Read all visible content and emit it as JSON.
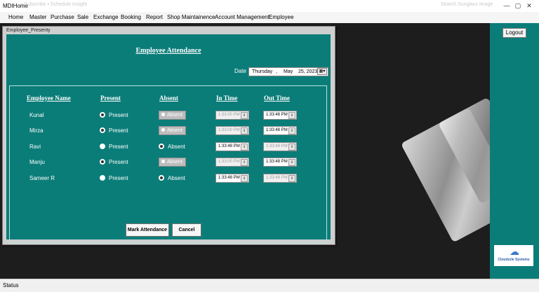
{
  "window": {
    "title": "MDIHome",
    "ghost_text": "▪  Subscribe  ▪  Schedule  Insight",
    "ghost_search": "Search Sunglass Image",
    "controls": [
      "—",
      "▢",
      "✕"
    ]
  },
  "menu": [
    "Home",
    "Master",
    "Purchase",
    "Sale",
    "Exchange",
    "Booking",
    "Report",
    "Shop Maintainence",
    "Account Management",
    "Employee"
  ],
  "right_panel": {
    "logout_label": "Logout",
    "brand_cloud": "☁",
    "brand_text": "Cloudzzle Systems"
  },
  "status": {
    "text": "Status"
  },
  "dialog": {
    "title": "Employee_Presenty",
    "heading": "Employee Attendance",
    "date_label": "Date",
    "date": {
      "weekday": "Thursday",
      "sep": ",",
      "month": "May",
      "day_year": "25, 2023",
      "picker_icon": "▦▾"
    },
    "columns": {
      "name": "Employee Name",
      "present": "Present",
      "absent": "Absent",
      "in_time": "In Time",
      "out_time": "Out Time"
    },
    "rows": [
      {
        "name": "Kunal",
        "present": "Present",
        "absent": "Absent",
        "in_time": "1:33:00 PM",
        "out_time": "1:33:48 PM"
      },
      {
        "name": "Mirza",
        "present": "Present",
        "absent": "Absent",
        "in_time": "1:33:00 PM",
        "out_time": "1:33:48 PM"
      },
      {
        "name": "Ravi",
        "present": "Present",
        "absent": "Absent",
        "in_time": "1:33:48 PM",
        "out_time": "1:33:48 PM"
      },
      {
        "name": "Manju",
        "present": "Present",
        "absent": "Absent",
        "in_time": "1:33:00 PM",
        "out_time": "1:33:48 PM"
      },
      {
        "name": "Sameer R",
        "present": "Present",
        "absent": "Absent",
        "in_time": "1:33:48 PM",
        "out_time": "1:33:48 PM"
      }
    ],
    "buttons": {
      "mark": "Mark Attendance",
      "cancel": "Cancel"
    },
    "spin_glyph": "⇕"
  },
  "colors": {
    "teal": "#0b7d79",
    "desktop": "#1d1d1d",
    "disabled": "#bdbdbd"
  }
}
